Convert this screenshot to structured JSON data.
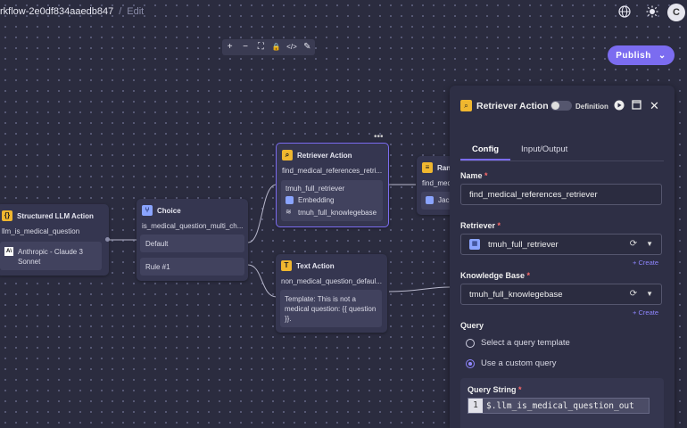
{
  "breadcrumb": {
    "workflow": "rkflow-2e0df834aaedb847",
    "separator": "/",
    "edit": "Edit"
  },
  "header_icons": [
    "globe-icon",
    "sun-icon"
  ],
  "user": {
    "initial": "C"
  },
  "toolbar_icons": [
    "+",
    "−",
    "⛶",
    "🔒",
    "</>",
    "✎"
  ],
  "publish": {
    "label": "Publish"
  },
  "nodes": {
    "structured": {
      "title": "Structured LLM Action",
      "name": "llm_is_medical_question",
      "model": "Anthropic - Claude 3 Sonnet"
    },
    "choice": {
      "title": "Choice",
      "name": "is_medical_question_multi_ch...",
      "option1": "Default",
      "option2": "Rule #1"
    },
    "retriever": {
      "title": "Retriever Action",
      "name": "find_medical_references_retri...",
      "retriever": "tmuh_full_retriever",
      "embedding": "Embedding",
      "kb": "tmuh_full_knowlegebase"
    },
    "text": {
      "title": "Text Action",
      "name": "non_medical_question_defaul...",
      "template": "Template: This is not a medical question: {{ question }}."
    },
    "partial": {
      "title": "Ran",
      "name": "find_medi",
      "item": "Jac"
    }
  },
  "panel": {
    "title": "Retriever Action",
    "definition_label": "Definition",
    "tabs": [
      "Config",
      "Input/Output"
    ],
    "name_label": "Name",
    "name_value": "find_medical_references_retriever",
    "retriever_label": "Retriever",
    "retriever_value": "tmuh_full_retriever",
    "create_label": "+ Create",
    "kb_label": "Knowledge Base",
    "kb_value": "tmuh_full_knowlegebase",
    "query_label": "Query",
    "radio_template": "Select a query template",
    "radio_custom": "Use a custom query",
    "query_string_label": "Query String",
    "code_line": "1",
    "code_text": "$.llm_is_medical_question_out"
  }
}
